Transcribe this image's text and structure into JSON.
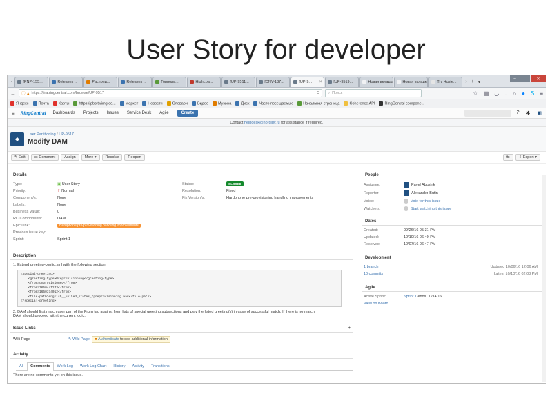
{
  "slide_title": "User Story for developer",
  "browser": {
    "tabs": [
      {
        "label": "[PNP-155...",
        "fav": "#6a7a8a"
      },
      {
        "label": "Releases ...",
        "fav": "#3b73af"
      },
      {
        "label": "Распред...",
        "fav": "#e07c00"
      },
      {
        "label": "Releases ...",
        "fav": "#3b73af"
      },
      {
        "label": "Горноль...",
        "fav": "#5a9a3a"
      },
      {
        "label": "HighLoa...",
        "fav": "#c0392b"
      },
      {
        "label": "[UP-9511...",
        "fav": "#6a7a8a"
      },
      {
        "label": "[CNV-187...",
        "fav": "#6a7a8a"
      },
      {
        "label": "[UP-9...",
        "fav": "#6a7a8a",
        "active": true
      },
      {
        "label": "[UP-9519...",
        "fav": "#6a7a8a"
      },
      {
        "label": "Новая вкладка",
        "fav": "#f0f1f3"
      },
      {
        "label": "Новая вкладка",
        "fav": "#f0f1f3"
      },
      {
        "label": "Try Hoste...",
        "fav": "#e5e5e5"
      }
    ],
    "url": "https://jira.ringcentral.com/browse/UP-9517",
    "search_placeholder": "Поиск",
    "bookmarks": [
      "Яндекс",
      "Почта",
      "Карты",
      "https://pbs.twimg.co...",
      "Маркет",
      "Новости",
      "Словари",
      "Видео",
      "Музыка",
      "Диск",
      "Часто посещаемые",
      "Начальная страница",
      "Coherence API",
      "RingCentral compone..."
    ]
  },
  "jira": {
    "logo": "RingCentral",
    "nav": [
      "Dashboards",
      "Projects",
      "Issues",
      "Service Desk",
      "Agile"
    ],
    "create": "Create",
    "banner_prefix": "Contact",
    "banner_email": "helpdesk@nordigy.ru",
    "banner_suffix": "for assistance if required.",
    "breadcrumb_project": "User Partitioning",
    "breadcrumb_key": "UP-9517",
    "summary": "Modify DAM",
    "ops": [
      "Edit",
      "Comment",
      "Assign",
      "More",
      "Resolve",
      "Reopen"
    ],
    "export": "Export"
  },
  "details": {
    "heading": "Details",
    "type_k": "Type:",
    "type_v": "User Story",
    "priority_k": "Priority:",
    "priority_v": "Normal",
    "components_k": "Component/s:",
    "components_v": "None",
    "labels_k": "Labels:",
    "labels_v": "None",
    "bv_k": "Business Value:",
    "bv_v": "0",
    "rc_k": "RC Components:",
    "rc_v": "DAM",
    "epic_k": "Epic Link:",
    "epic_v": "Hardphone pre-provisioning handling improvements",
    "prev_k": "Previous issue key:",
    "sprint_k": "Sprint:",
    "sprint_v": "Sprint 1",
    "status_k": "Status:",
    "status_v": "CLOSED",
    "resolution_k": "Resolution:",
    "resolution_v": "Fixed",
    "fix_k": "Fix Version/s:",
    "fix_v": "Hardphone pre-provisioning handling improvements"
  },
  "description": {
    "heading": "Description",
    "p1": "1. Extend greeting-config.xml with the following section:",
    "code": "<special-greeting>\n    <greeting-type>Preprovisioning</greeting-type>\n    <from>unprovisioned</from>\n    <from>1650441243</from>\n    <from>1650374012</from>\n    <file-path>english__united_states_/preprovisioning.wav</file-path>\n</special-greeting>",
    "p2": "2. DAM should first match user part of the From tag against from lists of special greeting subsections and play the listed greeting(s) in case of successful match. If there is no match,",
    "p3": "DAM should proceed with the current logic."
  },
  "issue_links": {
    "heading": "Issue Links",
    "wiki_k": "Wiki Page",
    "wiki_link": "Wiki Page:",
    "wiki_auth": "Authenticate",
    "wiki_rest": "to see additional information"
  },
  "activity": {
    "heading": "Activity",
    "tabs": [
      "All",
      "Comments",
      "Work Log",
      "Work Log Chart",
      "History",
      "Activity",
      "Transitions"
    ],
    "empty": "There are no comments yet on this issue."
  },
  "people": {
    "heading": "People",
    "assignee_k": "Assignee:",
    "assignee_v": "Pavel Abushik",
    "reporter_k": "Reporter:",
    "reporter_v": "Alexander Butin",
    "votes_k": "Votes:",
    "votes_v": "Vote for this issue",
    "watchers_k": "Watchers:",
    "watchers_v": "Start watching this issue"
  },
  "dates": {
    "heading": "Dates",
    "created_k": "Created:",
    "created_v": "09/26/16 05:31 PM",
    "updated_k": "Updated:",
    "updated_v": "10/10/16 06:40 PM",
    "resolved_k": "Resolved:",
    "resolved_v": "10/07/16 06:47 PM"
  },
  "development": {
    "heading": "Development",
    "branch": "1 branch",
    "branch_date": "Updated 10/06/16 12:06 AM",
    "commits": "10 commits",
    "commits_date": "Latest 10/10/16 02:08 PM"
  },
  "agile": {
    "heading": "Agile",
    "sprint_k": "Active Sprint:",
    "sprint_v": "Sprint 1",
    "sprint_end": "ends 10/14/16",
    "board": "View on Board"
  }
}
